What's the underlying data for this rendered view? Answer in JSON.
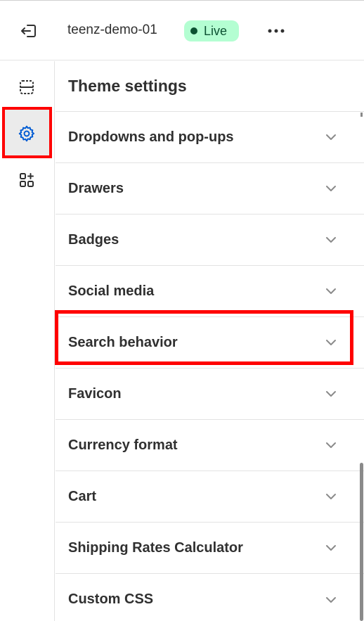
{
  "topbar": {
    "exit_icon": "exit-icon",
    "store_name": "teenz-demo-01",
    "status_badge": "Live",
    "status_color": "#b4fed2",
    "more_icon": "more-horizontal-icon"
  },
  "sidebar": {
    "items": [
      {
        "name": "sections",
        "icon": "sections-icon"
      },
      {
        "name": "theme-settings",
        "icon": "gear-icon",
        "active": true
      },
      {
        "name": "apps",
        "icon": "apps-add-icon"
      }
    ]
  },
  "panel": {
    "title": "Theme settings",
    "items": [
      {
        "label": "Dropdowns and pop-ups"
      },
      {
        "label": "Drawers"
      },
      {
        "label": "Badges"
      },
      {
        "label": "Social media"
      },
      {
        "label": "Search behavior"
      },
      {
        "label": "Favicon"
      },
      {
        "label": "Currency format"
      },
      {
        "label": "Cart"
      },
      {
        "label": "Shipping Rates Calculator"
      },
      {
        "label": "Custom CSS"
      }
    ]
  },
  "colors": {
    "accent": "#005bd3",
    "highlight": "#ff0000"
  }
}
